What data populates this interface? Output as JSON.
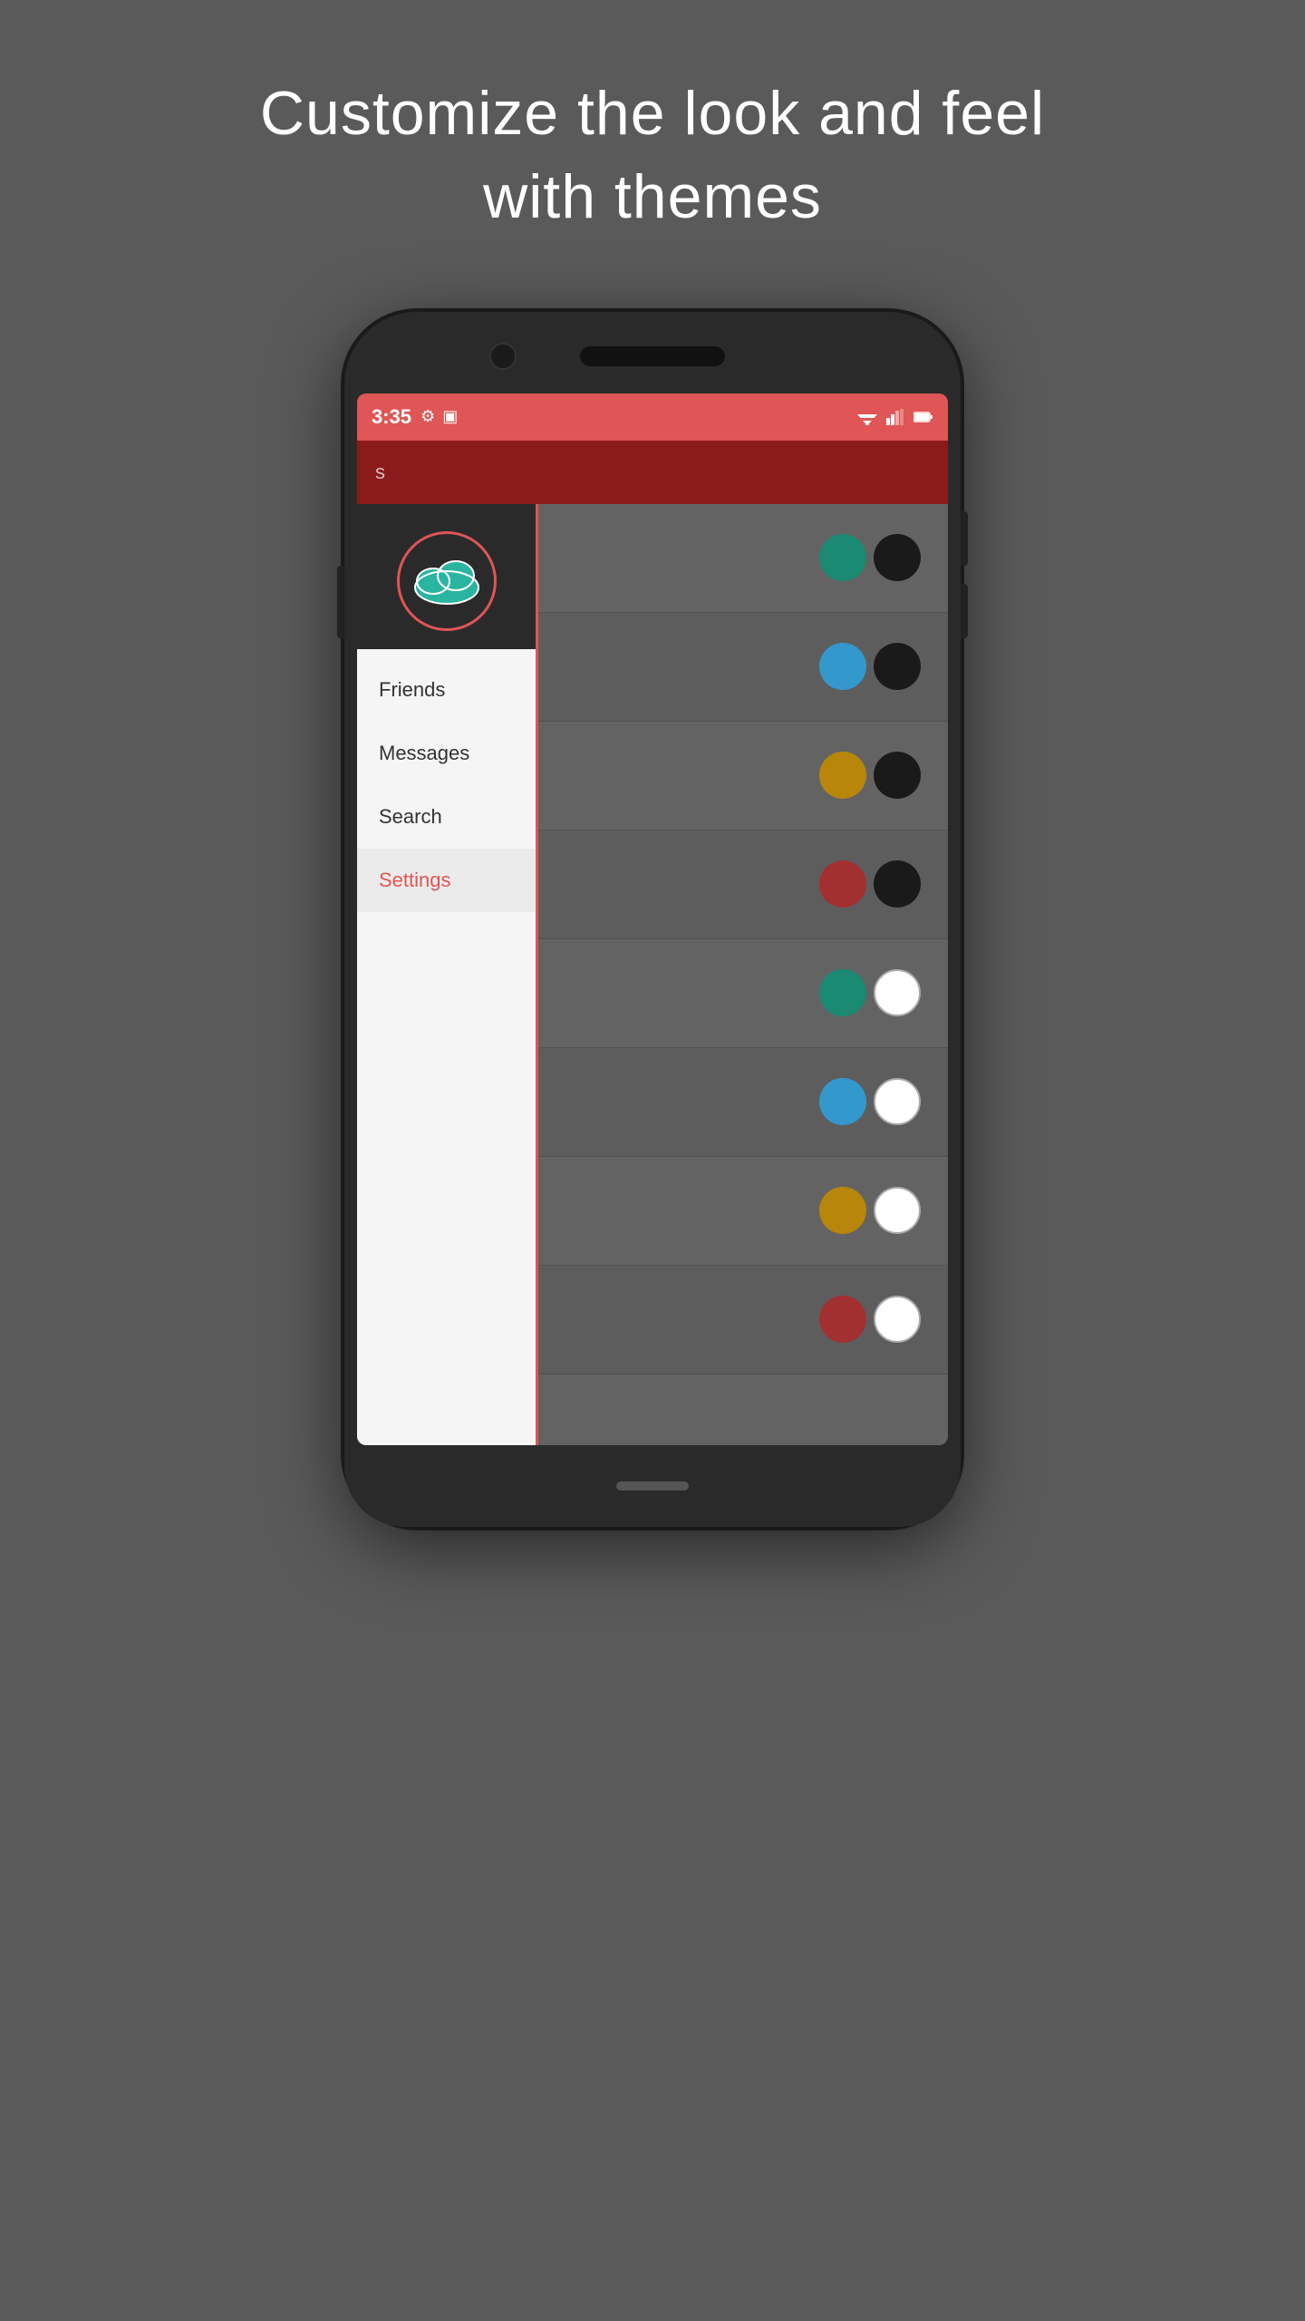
{
  "header": {
    "line1": "Customize the look and feel",
    "line2": "with themes"
  },
  "status_bar": {
    "time": "3:35",
    "bg_color": "#e05555"
  },
  "app_titlebar": {
    "text": "s",
    "bg_color": "#8B1A1A"
  },
  "sidebar": {
    "nav_items": [
      {
        "label": "Friends",
        "active": false
      },
      {
        "label": "Messages",
        "active": false
      },
      {
        "label": "Search",
        "active": false
      },
      {
        "label": "Settings",
        "active": true
      }
    ]
  },
  "theme_rows": [
    {
      "primary": "teal",
      "secondary": "black"
    },
    {
      "primary": "blue",
      "secondary": "black"
    },
    {
      "primary": "gold",
      "secondary": "black"
    },
    {
      "primary": "red",
      "secondary": "black"
    },
    {
      "primary": "teal",
      "secondary": "white"
    },
    {
      "primary": "blue",
      "secondary": "white"
    },
    {
      "primary": "gold",
      "secondary": "white"
    },
    {
      "primary": "red",
      "secondary": "white"
    }
  ],
  "icons": {
    "gear": "⚙",
    "battery": "🔋",
    "cloud_logo": "☁"
  }
}
